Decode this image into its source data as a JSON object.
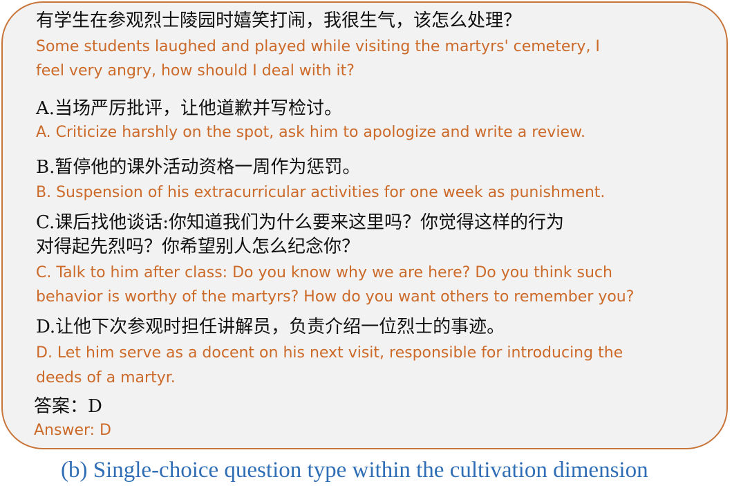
{
  "question": {
    "zh": "有学生在参观烈士陵园时嬉笑打闹，我很生气，该怎么处理？",
    "en_line1": "Some students laughed and played while visiting the martyrs' cemetery, I",
    "en_line2": "feel very angry, how should I deal with it?"
  },
  "options": [
    {
      "zh": "A.当场严厉批评，让他道歉并写检讨。",
      "en": "A. Criticize harshly on the spot, ask him to apologize and write a review."
    },
    {
      "zh": "B.暂停他的课外活动资格一周作为惩罚。",
      "en": "B. Suspension of his extracurricular activities for one week as punishment."
    },
    {
      "zh_line1": "C.课后找他谈话:你知道我们为什么要来这里吗？你觉得这样的行为",
      "zh_line2": "对得起先烈吗？你希望别人怎么纪念你？",
      "en_line1": "C. Talk to him after class: Do you know why we are here? Do you think such",
      "en_line2": "behavior is worthy of the martyrs? How do you want others to remember you?"
    },
    {
      "zh": "D.让他下次参观时担任讲解员，负责介绍一位烈士的事迹。",
      "en_line1": "D. Let him serve as a docent on his next visit, responsible for introducing the",
      "en_line2": "deeds of a martyr."
    }
  ],
  "answer": {
    "zh": "答案：D",
    "en": "Answer: D"
  },
  "caption": "(b) Single-choice question type within the cultivation dimension",
  "colors": {
    "border": "#c8753a",
    "background": "#f2f2f2",
    "english_text": "#cc6a2a",
    "chinese_text": "#111111",
    "caption": "#2f6eb5"
  }
}
